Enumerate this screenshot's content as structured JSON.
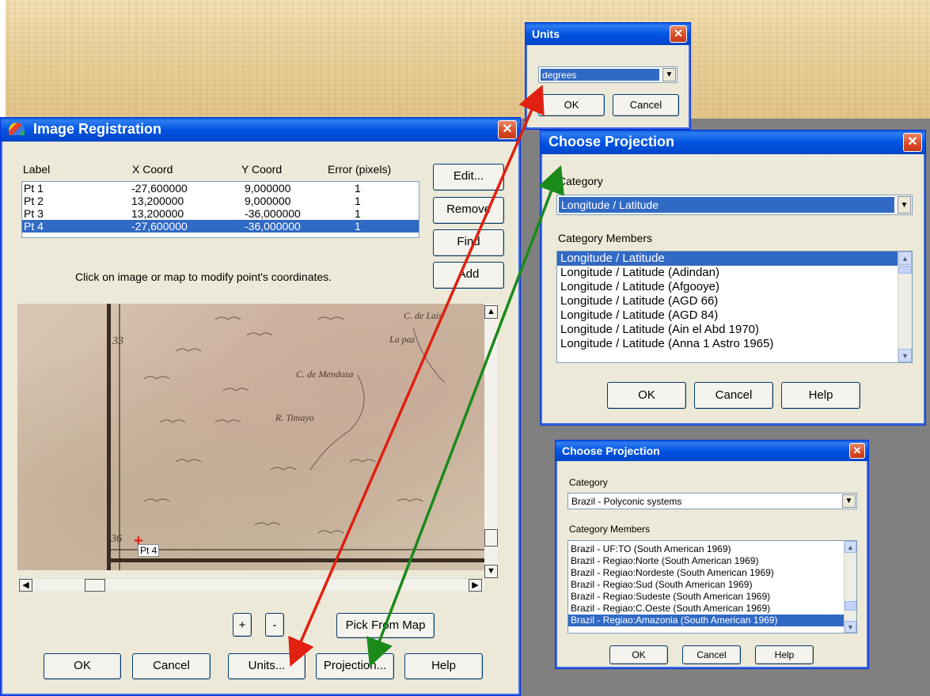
{
  "image_registration": {
    "title": "Image Registration",
    "close": "✕",
    "columns": [
      "Label",
      "X Coord",
      "Y Coord",
      "Error (pixels)"
    ],
    "points": [
      {
        "label": "Pt 1",
        "x": "-27,600000",
        "y": "9,000000",
        "err": "1"
      },
      {
        "label": "Pt 2",
        "x": "13,200000",
        "y": "9,000000",
        "err": "1"
      },
      {
        "label": "Pt 3",
        "x": "13,200000",
        "y": "-36,000000",
        "err": "1"
      },
      {
        "label": "Pt 4",
        "x": "-27,600000",
        "y": "-36,000000",
        "err": "1",
        "selected": true
      }
    ],
    "side_buttons": [
      "Edit...",
      "Remove",
      "Find",
      "Add"
    ],
    "hint": "Click on image or map to modify point's coordinates.",
    "map": {
      "labels": [
        "33",
        "36",
        "C. de Lais",
        "La paz",
        "C. de Mendoza",
        "R. Timayo"
      ],
      "point_label": "Pt 4"
    },
    "zoom_in": "+",
    "zoom_out": "-",
    "pick_from_map": "Pick From Map",
    "bottom_buttons": [
      "OK",
      "Cancel",
      "Units...",
      "Projection...",
      "Help"
    ]
  },
  "units_dialog": {
    "title": "Units",
    "close": "✕",
    "selected": "degrees",
    "ok": "OK",
    "cancel": "Cancel"
  },
  "choose_projection_1": {
    "title": "Choose Projection",
    "close": "✕",
    "category_label": "Category",
    "category_value": "Longitude / Latitude",
    "members_label": "Category Members",
    "members": [
      "Longitude / Latitude",
      "Longitude / Latitude (Adindan)",
      "Longitude / Latitude (Afgooye)",
      "Longitude / Latitude (AGD 66)",
      "Longitude / Latitude (AGD 84)",
      "Longitude / Latitude (Ain el Abd 1970)",
      "Longitude / Latitude (Anna 1 Astro 1965)"
    ],
    "selected_index": 0,
    "buttons": [
      "OK",
      "Cancel",
      "Help"
    ]
  },
  "choose_projection_2": {
    "title": "Choose Projection",
    "close": "✕",
    "category_label": "Category",
    "category_value": "Brazil - Polyconic systems",
    "members_label": "Category Members",
    "members": [
      "Brazil - UF:TO (South American 1969)",
      "Brazil - Regiao:Norte (South American 1969)",
      "Brazil - Regiao:Nordeste (South American 1969)",
      "Brazil - Regiao:Sud (South American 1969)",
      "Brazil - Regiao:Sudeste (South American 1969)",
      "Brazil - Regiao:C.Oeste (South American 1969)",
      "Brazil - Regiao:Amazonia (South American 1969)"
    ],
    "selected_index": 6,
    "buttons": [
      "OK",
      "Cancel",
      "Help"
    ]
  },
  "colors": {
    "title_blue": "#0054e3",
    "selection": "#316ac5",
    "arrow_red": "#e02010",
    "arrow_green": "#1a8a1a"
  }
}
